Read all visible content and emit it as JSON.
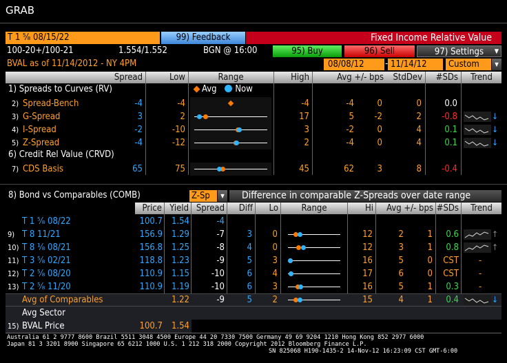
{
  "window_title": "GRAB",
  "security": {
    "label": "T 1 ⁵⁄₈ 08/15/22",
    "feedback": "99) Feedback",
    "title": "Fixed Income Relative Value"
  },
  "quote": {
    "bid_ask": "100-20+/100-21",
    "yields": "1.554/1.552",
    "source_time": "BGN @ 16:00"
  },
  "buttons": {
    "buy": "95) Buy",
    "sell": "96) Sell",
    "settings": "97) Settings"
  },
  "bval": {
    "label": "BVAL as of  11/14/2012 - NY 4PM",
    "date_from": "08/08/12",
    "date_to": "11/14/12",
    "period": "Custom"
  },
  "top_headers": {
    "spread": "Spread",
    "low": "Low",
    "range": "Range",
    "high": "High",
    "avg": "Avg +/- bps",
    "stddev": "StdDev",
    "sds": "#SDs",
    "trend": "Trend"
  },
  "legend": {
    "avg": "Avg",
    "now": "Now"
  },
  "sec1": "1) Spreads to Curves (RV)",
  "sec6": "6) Credit Rel Value (CRVD)",
  "top_rows": [
    {
      "num": "2)",
      "name": "Spread-Bench",
      "spread": "-4",
      "low": "-4",
      "high": "-4",
      "avg": "-4",
      "diff": "0",
      "std": "0",
      "sds": "0.0",
      "sds_color": "w",
      "avg_pos": 0.5,
      "now_pos": 0.5
    },
    {
      "num": "3)",
      "name": "G-Spread",
      "spread": "3",
      "low": "2",
      "high": "17",
      "avg": "5",
      "diff": "-2",
      "std": "2",
      "sds": "-0.8",
      "sds_color": "r",
      "avg_pos": 0.13,
      "now_pos": 0.04,
      "arrow": "↓"
    },
    {
      "num": "4)",
      "name": "I-Spread",
      "spread": "-2",
      "low": "-10",
      "high": "3",
      "avg": "-2",
      "diff": "0",
      "std": "4",
      "sds": "0.1",
      "sds_color": "g",
      "avg_pos": 0.6,
      "now_pos": 0.62,
      "arrow": "↓"
    },
    {
      "num": "5)",
      "name": "Z-Spread",
      "spread": "-4",
      "low": "-12",
      "high": "2",
      "avg": "-4",
      "diff": "0",
      "std": "4",
      "sds": "0.1",
      "sds_color": "g",
      "avg_pos": 0.57,
      "now_pos": 0.58,
      "arrow": "↓"
    },
    {
      "num": "7)",
      "name": "CDS Basis",
      "spread": "65",
      "low": "75",
      "high": "45",
      "avg": "62",
      "diff": "3",
      "std": "8",
      "sds": "-0.4",
      "sds_color": "r",
      "avg_pos": 0.38,
      "now_pos": 0.33
    }
  ],
  "comp": {
    "title": "8) Bond vs Comparables (COMB)",
    "dropdown": "Z-Sp",
    "desc": "Difference in comparable Z-Spreads over date range",
    "headers": {
      "price": "Price",
      "yield": "Yield",
      "spread": "Spread",
      "diff": "Diff",
      "lo": "Lo",
      "range": "Range",
      "hi": "Hi",
      "avg": "Avg +/- bps",
      "sds": "#SDs",
      "trend": "Trend"
    },
    "self": {
      "name": "T 1 ⁵⁄₈ 08/22",
      "price": "100.7",
      "yield": "1.54",
      "spread": "-4"
    },
    "rows": [
      {
        "num": "9)",
        "name": "T 8 11/21",
        "price": "156.9",
        "yield": "1.29",
        "spread": "-7",
        "diff": "3",
        "lo": "0",
        "hi": "12",
        "avg": "2",
        "pm": "1",
        "sds": "0.6",
        "now_pos": 0.2,
        "avg_pos": 0.12,
        "trend": "up"
      },
      {
        "num": "10)",
        "name": "T 8 ¹⁄₈ 08/21",
        "price": "156.8",
        "yield": "1.25",
        "spread": "-8",
        "diff": "4",
        "lo": "0",
        "hi": "12",
        "avg": "3",
        "pm": "1",
        "sds": "0.8",
        "now_pos": 0.27,
        "avg_pos": 0.17,
        "trend": "up"
      },
      {
        "num": "11)",
        "name": "T 3 ⁵⁄₈ 02/21",
        "price": "118.8",
        "yield": "1.23",
        "spread": "-9",
        "diff": "5",
        "lo": "3",
        "hi": "16",
        "avg": "5",
        "pm": "0",
        "sds": "CST",
        "now_pos": 0.0,
        "avg_pos": 0.0,
        "trend": "none"
      },
      {
        "num": "12)",
        "name": "T 2 ⁵⁄₈ 08/20",
        "price": "110.9",
        "yield": "1.15",
        "spread": "-10",
        "diff": "6",
        "lo": "4",
        "hi": "17",
        "avg": "6",
        "pm": "0",
        "sds": "CST",
        "now_pos": 0.02,
        "avg_pos": 0.02,
        "trend": "none"
      },
      {
        "num": "13)",
        "name": "T 2 ⁵⁄₈ 11/20",
        "price": "110.9",
        "yield": "1.19",
        "spread": "-10",
        "diff": "6",
        "lo": "3",
        "hi": "16",
        "avg": "5",
        "pm": "1",
        "sds": "0.3",
        "now_pos": 0.22,
        "avg_pos": 0.16,
        "trend": "none"
      }
    ],
    "avg_row": {
      "name": "Avg of Comparables",
      "yield": "1.22",
      "spread": "-9",
      "diff": "5",
      "lo": "2",
      "hi": "15",
      "avg": "4",
      "pm": "1",
      "sds": "0.4",
      "now_pos": 0.2,
      "avg_pos": 0.12
    },
    "avg_sector": "Avg Sector",
    "bval_price": {
      "num": "15)",
      "name": "BVAL Price",
      "price": "100.7",
      "yield": "1.54"
    }
  },
  "footer": {
    "line1": "Australia 61 2 9777 8600 Brazil 5511 3048 4500 Europe 44 20 7330 7500 Germany 49 69 9204 1210 Hong Kong 852 2977 6000",
    "line2": "Japan 81 3 3201 8900          Singapore 65 6212 1000          U.S. 1 212 318 2000          Copyright 2012 Bloomberg Finance L.P.",
    "line3": "SN 825068 H190-1435-2 14-Nov-12 16:23:09 CST  GMT-6:00"
  },
  "colors": {
    "orange": "#ffa028",
    "blue": "#2fa8ff",
    "red": "#ff2b2b",
    "green": "#3cd84b",
    "bar_red": "#d4001a"
  }
}
